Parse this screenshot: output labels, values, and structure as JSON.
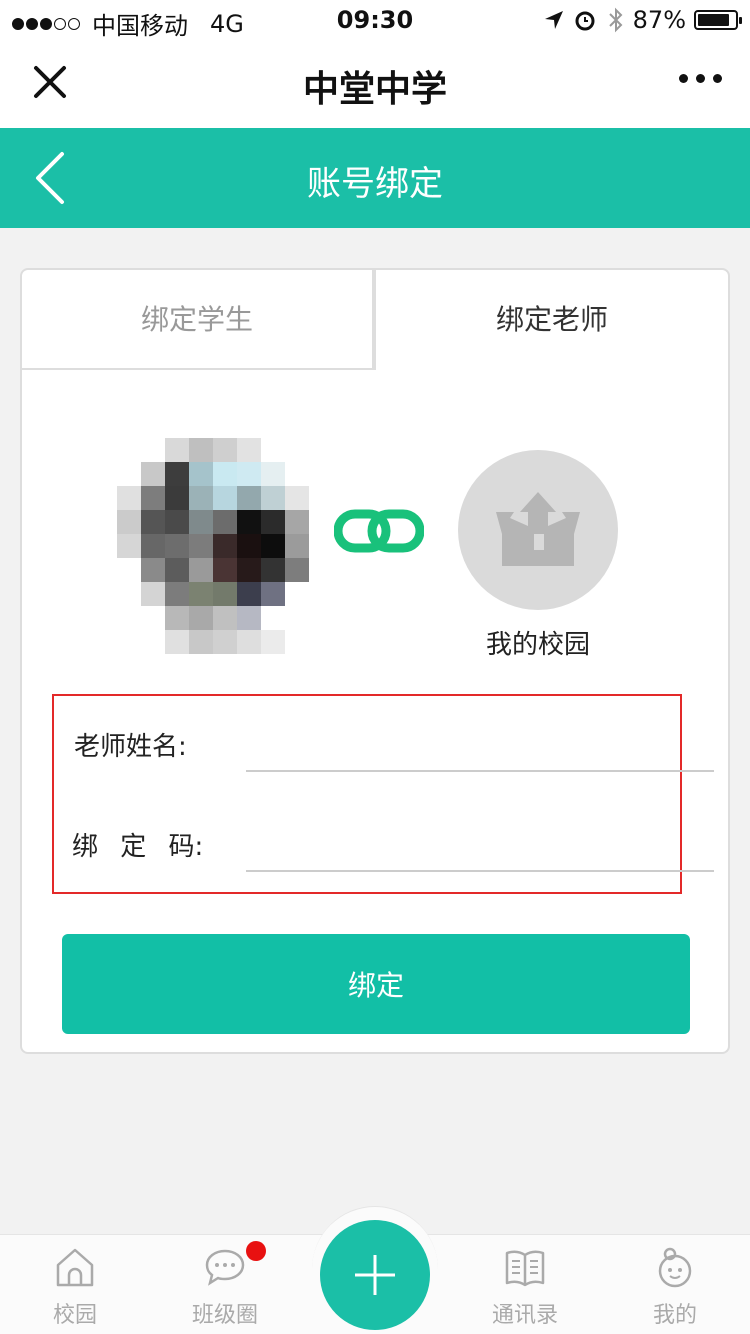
{
  "status_bar": {
    "carrier": "中国移动",
    "network": "4G",
    "time": "09:30",
    "battery": "87%",
    "battery_level": 0.87
  },
  "wechat_nav": {
    "title": "中堂中学"
  },
  "header": {
    "title": "账号绑定"
  },
  "tabs": [
    {
      "label": "绑定学生",
      "active": false
    },
    {
      "label": "绑定老师",
      "active": true
    }
  ],
  "school": {
    "name": "我的校园"
  },
  "form": {
    "teacher_name_label": "老师姓名:",
    "teacher_name_value": "",
    "bind_code_label": "绑 定 码:",
    "bind_code_value": ""
  },
  "bind_button": {
    "label": "绑定"
  },
  "tabbar": {
    "items": [
      {
        "label": "校园",
        "icon": "home-icon"
      },
      {
        "label": "班级圈",
        "icon": "chat-bubble-icon",
        "badge": true
      },
      {
        "label": "",
        "icon": "plus-icon"
      },
      {
        "label": "通讯录",
        "icon": "book-icon"
      },
      {
        "label": "我的",
        "icon": "profile-icon"
      }
    ]
  },
  "colors": {
    "primary": "#1bbfa7",
    "highlight_border": "#e32929",
    "link_icon": "#19c17b",
    "badge": "#e81111"
  }
}
